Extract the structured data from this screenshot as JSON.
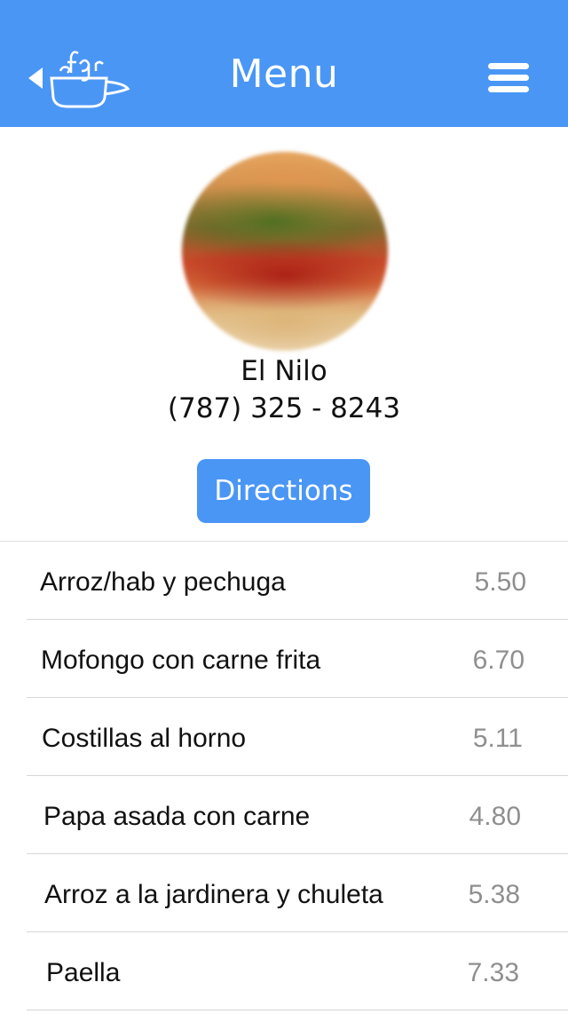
{
  "header": {
    "title": "Menu",
    "accent_color": "#4a96f5",
    "back_icon": "coffee-cup-back-icon",
    "menu_icon": "hamburger-icon"
  },
  "restaurant": {
    "name": "El Nilo",
    "phone": "(787) 325 - 8243",
    "photo": "burger-photo",
    "directions_label": "Directions"
  },
  "menu": {
    "items": [
      {
        "name": "Arroz/hab y pechuga",
        "price": "5.50"
      },
      {
        "name": "Mofongo con carne frita",
        "price": "6.70"
      },
      {
        "name": "Costillas al horno",
        "price": "5.11"
      },
      {
        "name": "Papa asada con carne",
        "price": "4.80"
      },
      {
        "name": "Arroz a la jardinera y chuleta",
        "price": "5.38"
      },
      {
        "name": "Paella",
        "price": "7.33"
      }
    ]
  }
}
